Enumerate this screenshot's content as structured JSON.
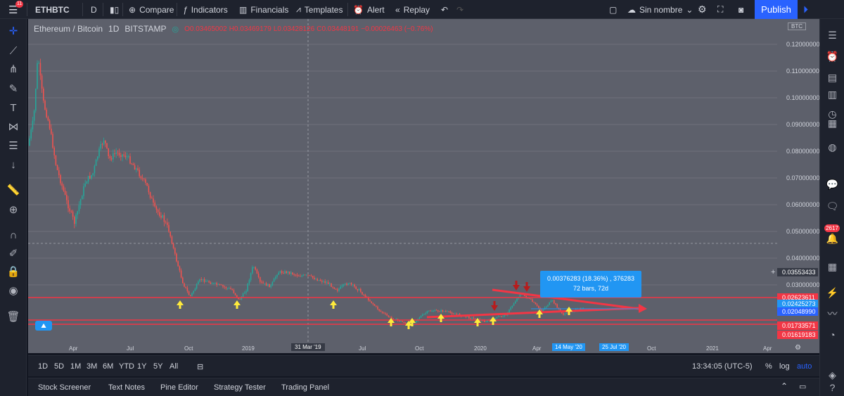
{
  "top": {
    "badge": "11",
    "symbol": "ETHBTC",
    "interval": "D",
    "compare": "Compare",
    "indicators": "Indicators",
    "financials": "Financials",
    "templates": "Templates",
    "alert": "Alert",
    "replay": "Replay",
    "layout_name": "Sin nombre",
    "publish": "Publish"
  },
  "legend": {
    "title": "Ethereum / Bitcoin",
    "interval": "1D",
    "exchange": "BITSTAMP",
    "open": "O0.03465002",
    "high": "H0.03469179",
    "low": "L0.03428126",
    "close": "C0.03448191",
    "change": "−0.00026463 (−0.76%)"
  },
  "currency": "BTC",
  "y_ticks": [
    "0.12000000",
    "0.11000000",
    "0.10000000",
    "0.09000000",
    "0.08000000",
    "0.07000000",
    "0.06000000",
    "0.05000000",
    "0.04000000",
    "0.03000000"
  ],
  "price_tags": {
    "crosshair": "0.03553433",
    "red1": "0.02623611",
    "blue": "0.02425273",
    "cur": "0.02048990",
    "red2": "0.01733571",
    "red3": "0.01619183"
  },
  "x_ticks": [
    "Apr",
    "Jul",
    "Oct",
    "2019",
    "Jul",
    "Oct",
    "2020",
    "Apr",
    "Oct",
    "2021",
    "Apr"
  ],
  "x_cursor": "31 Mar '19",
  "x_range": [
    "14 May '20",
    "25 Jul '20"
  ],
  "measure": {
    "line1": "0.00376283 (18.36%) , 376283",
    "line2": "72 bars, 72d"
  },
  "ranges": [
    "1D",
    "5D",
    "1M",
    "3M",
    "6M",
    "YTD",
    "1Y",
    "5Y",
    "All"
  ],
  "clock": "13:34:05 (UTC-5)",
  "scale": {
    "pct": "%",
    "log": "log",
    "auto": "auto"
  },
  "tabs": [
    "Stock Screener",
    "Text Notes",
    "Pine Editor",
    "Strategy Tester",
    "Trading Panel"
  ],
  "notif_count": "2617",
  "colors": {
    "up": "#26a69a",
    "down": "#ef5350",
    "accent": "#2962ff",
    "bg": "#5d606b"
  }
}
